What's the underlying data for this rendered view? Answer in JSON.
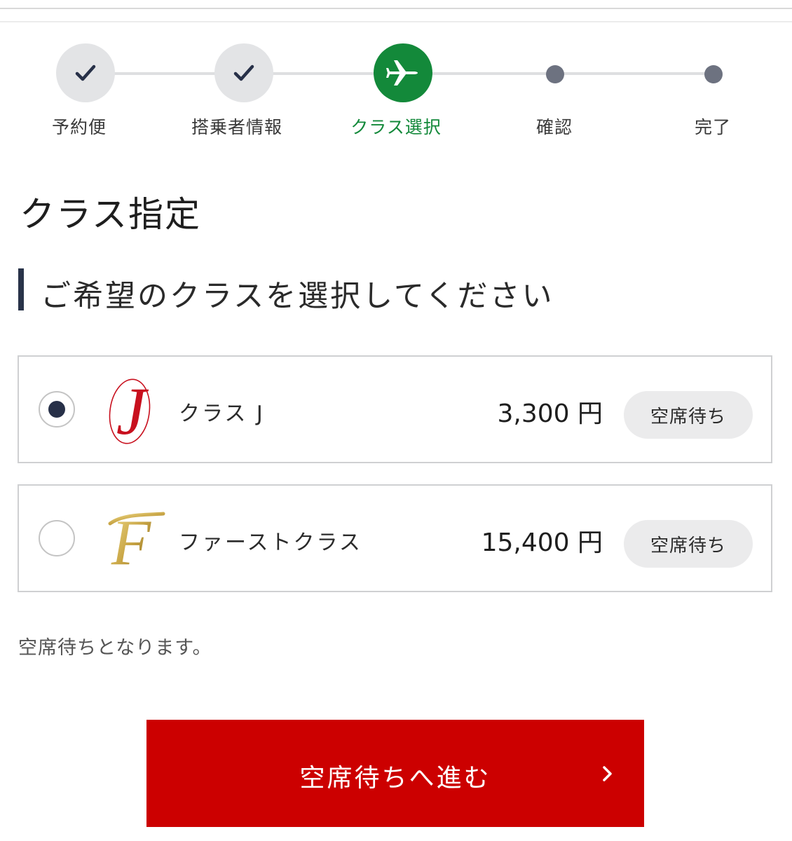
{
  "stepper": {
    "steps": [
      {
        "label": "予約便",
        "state": "done",
        "icon": "check-icon"
      },
      {
        "label": "搭乗者情報",
        "state": "done",
        "icon": "check-icon"
      },
      {
        "label": "クラス選択",
        "state": "current",
        "icon": "airplane-icon"
      },
      {
        "label": "確認",
        "state": "todo",
        "icon": "dot-icon"
      },
      {
        "label": "完了",
        "state": "todo",
        "icon": "dot-icon"
      }
    ]
  },
  "page": {
    "title": "クラス指定",
    "section_title": "ご希望のクラスを選択してください"
  },
  "options": [
    {
      "name": "クラス J",
      "price": "3,300 円",
      "status": "空席待ち",
      "selected": true,
      "logo": "class-j-logo"
    },
    {
      "name": "ファーストクラス",
      "price": "15,400 円",
      "status": "空席待ち",
      "selected": false,
      "logo": "first-class-logo"
    }
  ],
  "note": "空席待ちとなります。",
  "proceed_button": {
    "label": "空席待ちへ進む",
    "icon": "chevron-right-icon"
  },
  "colors": {
    "accent_green": "#13893a",
    "primary_red": "#cc0000",
    "navy": "#273048",
    "j_red": "#c8101e",
    "f_gold": "#c9a646"
  }
}
